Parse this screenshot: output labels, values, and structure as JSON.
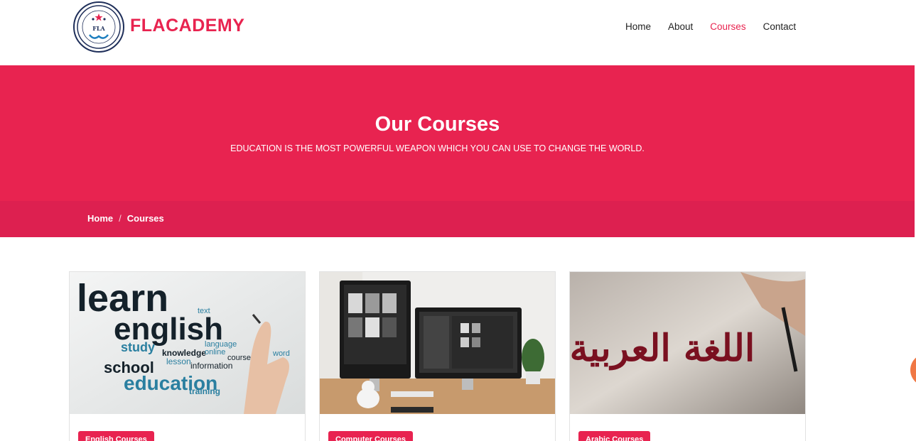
{
  "brand": {
    "name": "FLACADEMY",
    "logo_text": "FLA",
    "logo_icon": "academy-seal-icon"
  },
  "nav": {
    "items": [
      {
        "label": "Home",
        "active": false
      },
      {
        "label": "About",
        "active": false
      },
      {
        "label": "Courses",
        "active": true
      },
      {
        "label": "Contact",
        "active": false
      }
    ]
  },
  "hero": {
    "title": "Our Courses",
    "subtitle": "EDUCATION IS THE MOST POWERFUL WEAPON WHICH YOU CAN USE TO CHANGE THE WORLD."
  },
  "breadcrumb": {
    "home": "Home",
    "separator": "/",
    "current": "Courses"
  },
  "courses": [
    {
      "tag": "English Courses",
      "image_words": [
        "learn",
        "english",
        "study",
        "school",
        "education",
        "language",
        "knowledge",
        "training",
        "lesson",
        "information",
        "online",
        "course",
        "word",
        "text"
      ]
    },
    {
      "tag": "Computer Courses"
    },
    {
      "tag": "Arabic Courses",
      "image_text": "اللغة العربية"
    }
  ],
  "colors": {
    "accent": "#e82350",
    "accent_dark": "#dd2050",
    "navy": "#1f2f5a"
  }
}
